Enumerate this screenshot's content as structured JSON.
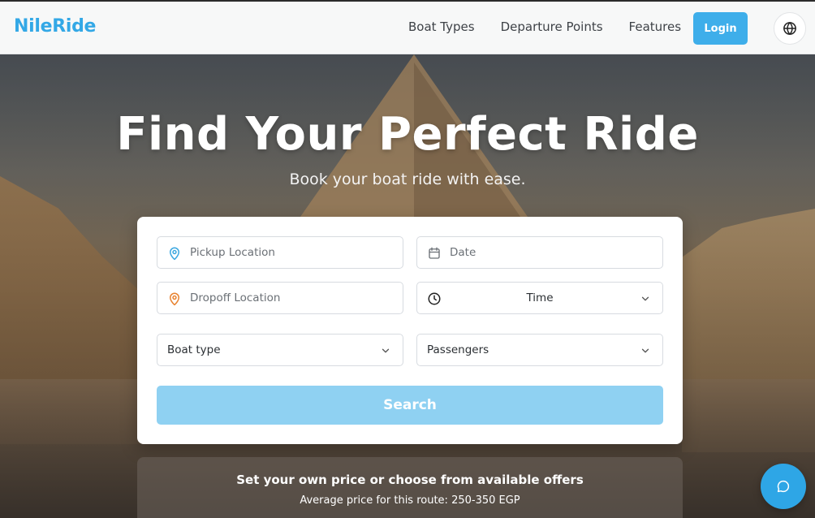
{
  "header": {
    "brand": "NileRide",
    "nav": [
      "Boat Types",
      "Departure Points",
      "Features"
    ],
    "login_label": "Login",
    "language_icon": "globe-icon"
  },
  "hero": {
    "title": "Find Your Perfect Ride",
    "subtitle": "Book your boat ride with ease."
  },
  "booking": {
    "pickup": {
      "placeholder": "Pickup Location",
      "value": "",
      "icon": "map-pin-icon",
      "icon_color": "#3aa7e0"
    },
    "date": {
      "placeholder": "Date",
      "value": "",
      "icon": "calendar-icon"
    },
    "dropoff": {
      "placeholder": "Dropoff Location",
      "value": "",
      "icon": "map-pin-icon",
      "icon_color": "#e8822f"
    },
    "time": {
      "label": "Time",
      "icon": "clock-icon"
    },
    "boat_type": {
      "label": "Boat type"
    },
    "passengers": {
      "label": "Passengers"
    },
    "search_label": "Search"
  },
  "offer": {
    "title": "Set your own price or choose from available offers",
    "subtitle": "Average price for this route: 250-350 EGP"
  },
  "colors": {
    "accent": "#33a8e6",
    "search_disabled": "#8fd1f2",
    "pickup_pin": "#3aa7e0",
    "dropoff_pin": "#e8822f"
  }
}
